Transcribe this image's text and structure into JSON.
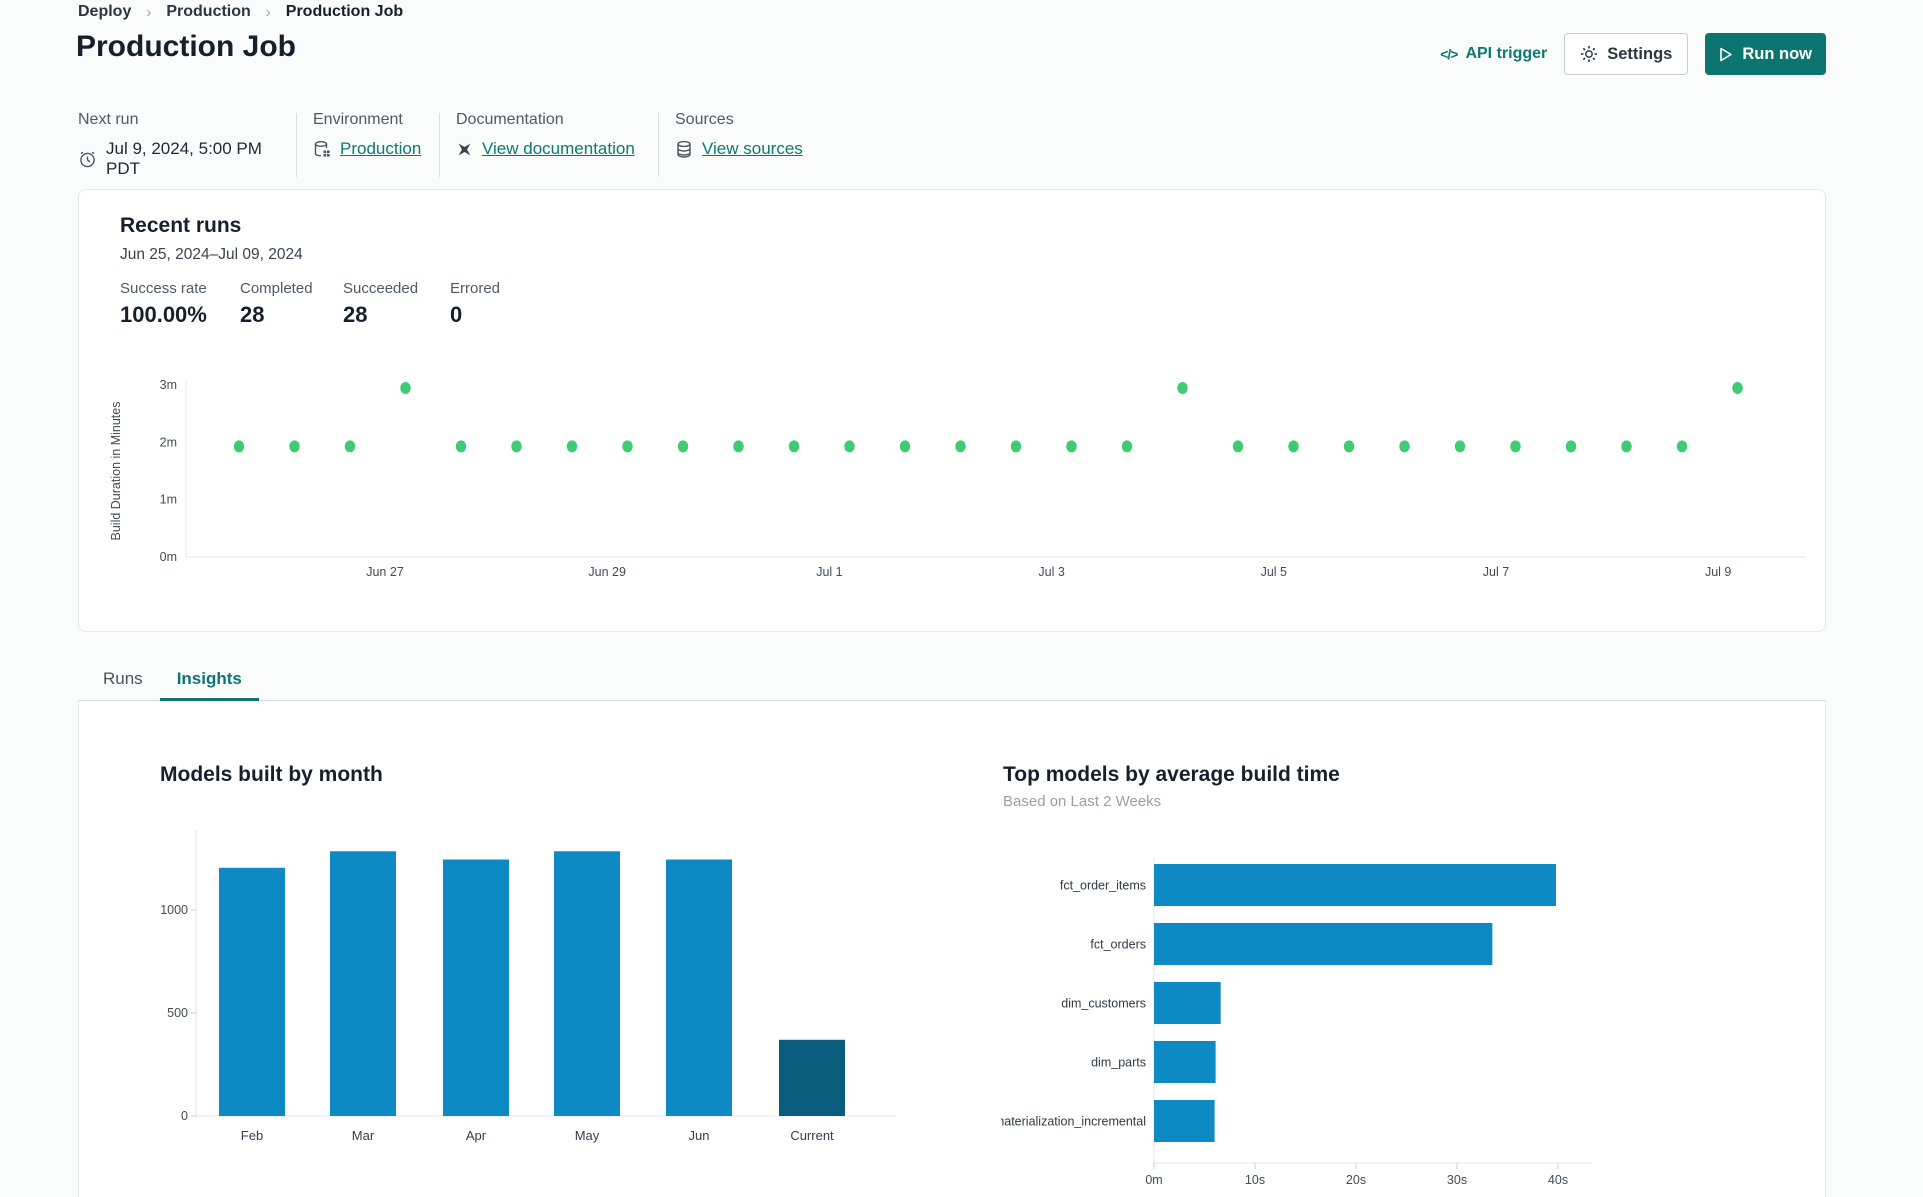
{
  "breadcrumb": {
    "items": [
      {
        "label": "Deploy"
      },
      {
        "label": "Production"
      },
      {
        "label": "Production Job"
      }
    ]
  },
  "header": {
    "title": "Production Job",
    "api_trigger_label": "API trigger",
    "settings_label": "Settings",
    "run_now_label": "Run now"
  },
  "job_info": [
    {
      "label": "Next run",
      "value": "Jul 9, 2024, 5:00 PM PDT"
    },
    {
      "label": "Environment",
      "value": "Production"
    },
    {
      "label": "Documentation",
      "value": "View documentation"
    },
    {
      "label": "Sources",
      "value": "View sources"
    }
  ],
  "recent_runs": {
    "title": "Recent runs",
    "date_range": "Jun 25, 2024–Jul 09, 2024",
    "stats": [
      {
        "label": "Success rate",
        "value": "100.00%"
      },
      {
        "label": "Completed",
        "value": "28"
      },
      {
        "label": "Succeeded",
        "value": "28"
      },
      {
        "label": "Errored",
        "value": "0"
      }
    ]
  },
  "tabs": [
    {
      "label": "Runs",
      "active": false
    },
    {
      "label": "Insights",
      "active": true
    }
  ],
  "chart_data": [
    {
      "id": "build-duration-scatter",
      "type": "scatter",
      "ylabel": "Build Duration in Minutes",
      "ytick_labels": [
        "0m",
        "1m",
        "2m",
        "3m"
      ],
      "ytick_minutes": [
        0,
        1,
        2,
        3
      ],
      "ylim_minutes": [
        0,
        3.5
      ],
      "xtick_labels": [
        "Jun 27",
        "Jun 29",
        "Jul 1",
        "Jul 3",
        "Jul 5",
        "Jul 7",
        "Jul 9"
      ],
      "runs_build_minutes": [
        1.93,
        1.93,
        1.93,
        2.95,
        1.93,
        1.93,
        1.93,
        1.93,
        1.93,
        1.93,
        1.93,
        1.93,
        1.93,
        1.93,
        1.93,
        1.93,
        1.93,
        2.95,
        1.93,
        1.93,
        1.93,
        1.93,
        1.93,
        1.93,
        1.93,
        1.93,
        1.93,
        2.95
      ],
      "point_color": "#3ecb72",
      "grid": false
    },
    {
      "id": "models-built-by-month",
      "type": "bar",
      "title": "Models built by month",
      "categories": [
        "Feb",
        "Mar",
        "Apr",
        "May",
        "Jun",
        "Current"
      ],
      "values": [
        1205,
        1285,
        1245,
        1285,
        1245,
        370
      ],
      "ytick_values": [
        0,
        500,
        1000
      ],
      "ylim": [
        0,
        1440
      ],
      "bar_color": "#0d89c3",
      "current_bar_color": "#0a5c7d",
      "current_index": 5,
      "grid": false
    },
    {
      "id": "top-models-by-average-build-time",
      "type": "horizontal-bar",
      "title": "Top models by average build time",
      "subtitle": "Based on Last 2 Weeks",
      "categories": [
        "fct_order_items",
        "fct_orders",
        "dim_customers",
        "dim_parts",
        "materialization_incremental"
      ],
      "values_seconds": [
        39.8,
        33.5,
        6.6,
        6.1,
        6.0
      ],
      "xtick_labels": [
        "0m",
        "10s",
        "20s",
        "30s",
        "40s"
      ],
      "xtick_seconds": [
        0,
        10,
        20,
        30,
        40
      ],
      "xlim_seconds": [
        0,
        45
      ],
      "bar_color": "#0d89c3",
      "grid": false
    }
  ],
  "colors": {
    "accent_teal": "#0d7570",
    "link_teal": "#0c7a70",
    "success_green": "#3ecb72",
    "bar_blue": "#0d89c3",
    "bar_dark": "#0a5c7d"
  }
}
